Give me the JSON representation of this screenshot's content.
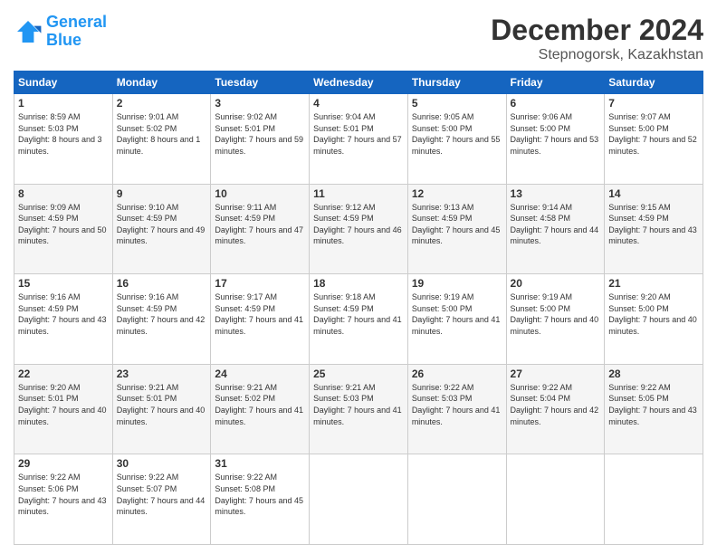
{
  "header": {
    "logo_line1": "General",
    "logo_line2": "Blue",
    "title": "December 2024",
    "subtitle": "Stepnogorsk, Kazakhstan"
  },
  "days_of_week": [
    "Sunday",
    "Monday",
    "Tuesday",
    "Wednesday",
    "Thursday",
    "Friday",
    "Saturday"
  ],
  "weeks": [
    [
      {
        "day": "1",
        "sunrise": "Sunrise: 8:59 AM",
        "sunset": "Sunset: 5:03 PM",
        "daylight": "Daylight: 8 hours and 3 minutes."
      },
      {
        "day": "2",
        "sunrise": "Sunrise: 9:01 AM",
        "sunset": "Sunset: 5:02 PM",
        "daylight": "Daylight: 8 hours and 1 minute."
      },
      {
        "day": "3",
        "sunrise": "Sunrise: 9:02 AM",
        "sunset": "Sunset: 5:01 PM",
        "daylight": "Daylight: 7 hours and 59 minutes."
      },
      {
        "day": "4",
        "sunrise": "Sunrise: 9:04 AM",
        "sunset": "Sunset: 5:01 PM",
        "daylight": "Daylight: 7 hours and 57 minutes."
      },
      {
        "day": "5",
        "sunrise": "Sunrise: 9:05 AM",
        "sunset": "Sunset: 5:00 PM",
        "daylight": "Daylight: 7 hours and 55 minutes."
      },
      {
        "day": "6",
        "sunrise": "Sunrise: 9:06 AM",
        "sunset": "Sunset: 5:00 PM",
        "daylight": "Daylight: 7 hours and 53 minutes."
      },
      {
        "day": "7",
        "sunrise": "Sunrise: 9:07 AM",
        "sunset": "Sunset: 5:00 PM",
        "daylight": "Daylight: 7 hours and 52 minutes."
      }
    ],
    [
      {
        "day": "8",
        "sunrise": "Sunrise: 9:09 AM",
        "sunset": "Sunset: 4:59 PM",
        "daylight": "Daylight: 7 hours and 50 minutes."
      },
      {
        "day": "9",
        "sunrise": "Sunrise: 9:10 AM",
        "sunset": "Sunset: 4:59 PM",
        "daylight": "Daylight: 7 hours and 49 minutes."
      },
      {
        "day": "10",
        "sunrise": "Sunrise: 9:11 AM",
        "sunset": "Sunset: 4:59 PM",
        "daylight": "Daylight: 7 hours and 47 minutes."
      },
      {
        "day": "11",
        "sunrise": "Sunrise: 9:12 AM",
        "sunset": "Sunset: 4:59 PM",
        "daylight": "Daylight: 7 hours and 46 minutes."
      },
      {
        "day": "12",
        "sunrise": "Sunrise: 9:13 AM",
        "sunset": "Sunset: 4:59 PM",
        "daylight": "Daylight: 7 hours and 45 minutes."
      },
      {
        "day": "13",
        "sunrise": "Sunrise: 9:14 AM",
        "sunset": "Sunset: 4:58 PM",
        "daylight": "Daylight: 7 hours and 44 minutes."
      },
      {
        "day": "14",
        "sunrise": "Sunrise: 9:15 AM",
        "sunset": "Sunset: 4:59 PM",
        "daylight": "Daylight: 7 hours and 43 minutes."
      }
    ],
    [
      {
        "day": "15",
        "sunrise": "Sunrise: 9:16 AM",
        "sunset": "Sunset: 4:59 PM",
        "daylight": "Daylight: 7 hours and 43 minutes."
      },
      {
        "day": "16",
        "sunrise": "Sunrise: 9:16 AM",
        "sunset": "Sunset: 4:59 PM",
        "daylight": "Daylight: 7 hours and 42 minutes."
      },
      {
        "day": "17",
        "sunrise": "Sunrise: 9:17 AM",
        "sunset": "Sunset: 4:59 PM",
        "daylight": "Daylight: 7 hours and 41 minutes."
      },
      {
        "day": "18",
        "sunrise": "Sunrise: 9:18 AM",
        "sunset": "Sunset: 4:59 PM",
        "daylight": "Daylight: 7 hours and 41 minutes."
      },
      {
        "day": "19",
        "sunrise": "Sunrise: 9:19 AM",
        "sunset": "Sunset: 5:00 PM",
        "daylight": "Daylight: 7 hours and 41 minutes."
      },
      {
        "day": "20",
        "sunrise": "Sunrise: 9:19 AM",
        "sunset": "Sunset: 5:00 PM",
        "daylight": "Daylight: 7 hours and 40 minutes."
      },
      {
        "day": "21",
        "sunrise": "Sunrise: 9:20 AM",
        "sunset": "Sunset: 5:00 PM",
        "daylight": "Daylight: 7 hours and 40 minutes."
      }
    ],
    [
      {
        "day": "22",
        "sunrise": "Sunrise: 9:20 AM",
        "sunset": "Sunset: 5:01 PM",
        "daylight": "Daylight: 7 hours and 40 minutes."
      },
      {
        "day": "23",
        "sunrise": "Sunrise: 9:21 AM",
        "sunset": "Sunset: 5:01 PM",
        "daylight": "Daylight: 7 hours and 40 minutes."
      },
      {
        "day": "24",
        "sunrise": "Sunrise: 9:21 AM",
        "sunset": "Sunset: 5:02 PM",
        "daylight": "Daylight: 7 hours and 41 minutes."
      },
      {
        "day": "25",
        "sunrise": "Sunrise: 9:21 AM",
        "sunset": "Sunset: 5:03 PM",
        "daylight": "Daylight: 7 hours and 41 minutes."
      },
      {
        "day": "26",
        "sunrise": "Sunrise: 9:22 AM",
        "sunset": "Sunset: 5:03 PM",
        "daylight": "Daylight: 7 hours and 41 minutes."
      },
      {
        "day": "27",
        "sunrise": "Sunrise: 9:22 AM",
        "sunset": "Sunset: 5:04 PM",
        "daylight": "Daylight: 7 hours and 42 minutes."
      },
      {
        "day": "28",
        "sunrise": "Sunrise: 9:22 AM",
        "sunset": "Sunset: 5:05 PM",
        "daylight": "Daylight: 7 hours and 43 minutes."
      }
    ],
    [
      {
        "day": "29",
        "sunrise": "Sunrise: 9:22 AM",
        "sunset": "Sunset: 5:06 PM",
        "daylight": "Daylight: 7 hours and 43 minutes."
      },
      {
        "day": "30",
        "sunrise": "Sunrise: 9:22 AM",
        "sunset": "Sunset: 5:07 PM",
        "daylight": "Daylight: 7 hours and 44 minutes."
      },
      {
        "day": "31",
        "sunrise": "Sunrise: 9:22 AM",
        "sunset": "Sunset: 5:08 PM",
        "daylight": "Daylight: 7 hours and 45 minutes."
      },
      null,
      null,
      null,
      null
    ]
  ]
}
